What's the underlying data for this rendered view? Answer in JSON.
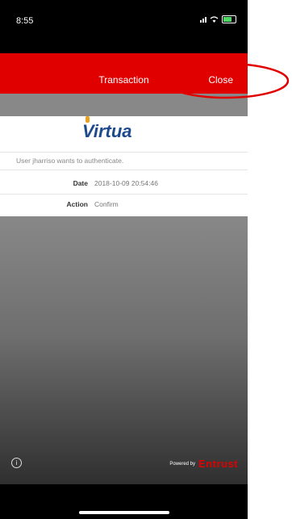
{
  "status": {
    "time": "8:55"
  },
  "navbar": {
    "title": "Transaction",
    "close_label": "Close"
  },
  "card": {
    "logo_text": "Virtua",
    "message": "User jharriso wants to authenticate.",
    "date_label": "Date",
    "date_value": "2018-10-09 20:54:46",
    "action_label": "Action",
    "action_value": "Confirm"
  },
  "footer": {
    "info_icon": "info-circle-icon",
    "powered_by": "Powered by",
    "brand": "Entrust"
  },
  "colors": {
    "navbar": "#e10000",
    "highlight": "#e10000",
    "logo": "#1e4a8c"
  }
}
